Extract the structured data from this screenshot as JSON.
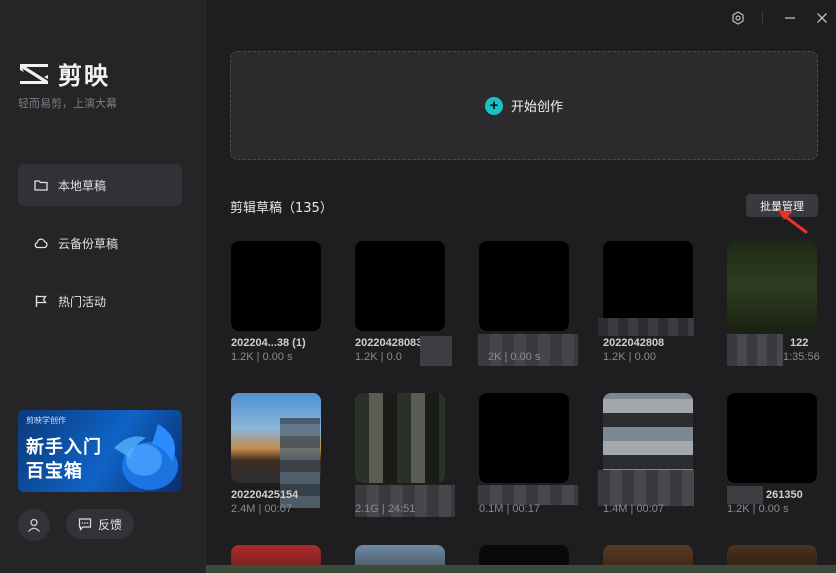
{
  "app": {
    "name": "剪映",
    "slogan": "轻而易剪，上演大幕"
  },
  "sidebar": {
    "items": [
      {
        "label": "本地草稿",
        "icon": "folder-icon",
        "active": true
      },
      {
        "label": "云备份草稿",
        "icon": "cloud-icon",
        "active": false
      },
      {
        "label": "热门活动",
        "icon": "flag-icon",
        "active": false
      }
    ],
    "banner": {
      "top_text": "剪映学创作",
      "line1": "新手入门",
      "line2": "百宝箱"
    },
    "feedback_label": "反馈"
  },
  "window_controls": {
    "settings_icon": "gear-icon",
    "minimize_icon": "minimize-icon",
    "close_icon": "close-icon"
  },
  "main": {
    "create_label": "开始创作",
    "section_title": "剪辑草稿（135）",
    "batch_label": "批量管理",
    "drafts": [
      {
        "name": "202204...38 (1)",
        "meta": "1.2K | 0.00 s"
      },
      {
        "name": "20220428083",
        "meta": "1.2K | 0.0"
      },
      {
        "name": "",
        "meta": "2K | 0.00 s"
      },
      {
        "name": "2022042808",
        "meta": "1.2K | 0.00"
      },
      {
        "name": "122",
        "meta": "1:35:56"
      },
      {
        "name": "20220425154",
        "meta": "2.4M | 00:07"
      },
      {
        "name": "",
        "meta": "2.1G | 24:51"
      },
      {
        "name": "",
        "meta": "0.1M | 00:17"
      },
      {
        "name": "",
        "meta": "1.4M | 00:07"
      },
      {
        "name": "261350",
        "meta": "1.2K | 0.00 s"
      }
    ]
  },
  "colors": {
    "accent": "#19c2c9",
    "sidebar_bg": "#252528",
    "main_bg": "#1e1e20",
    "card_bg": "#2b2b2e"
  }
}
